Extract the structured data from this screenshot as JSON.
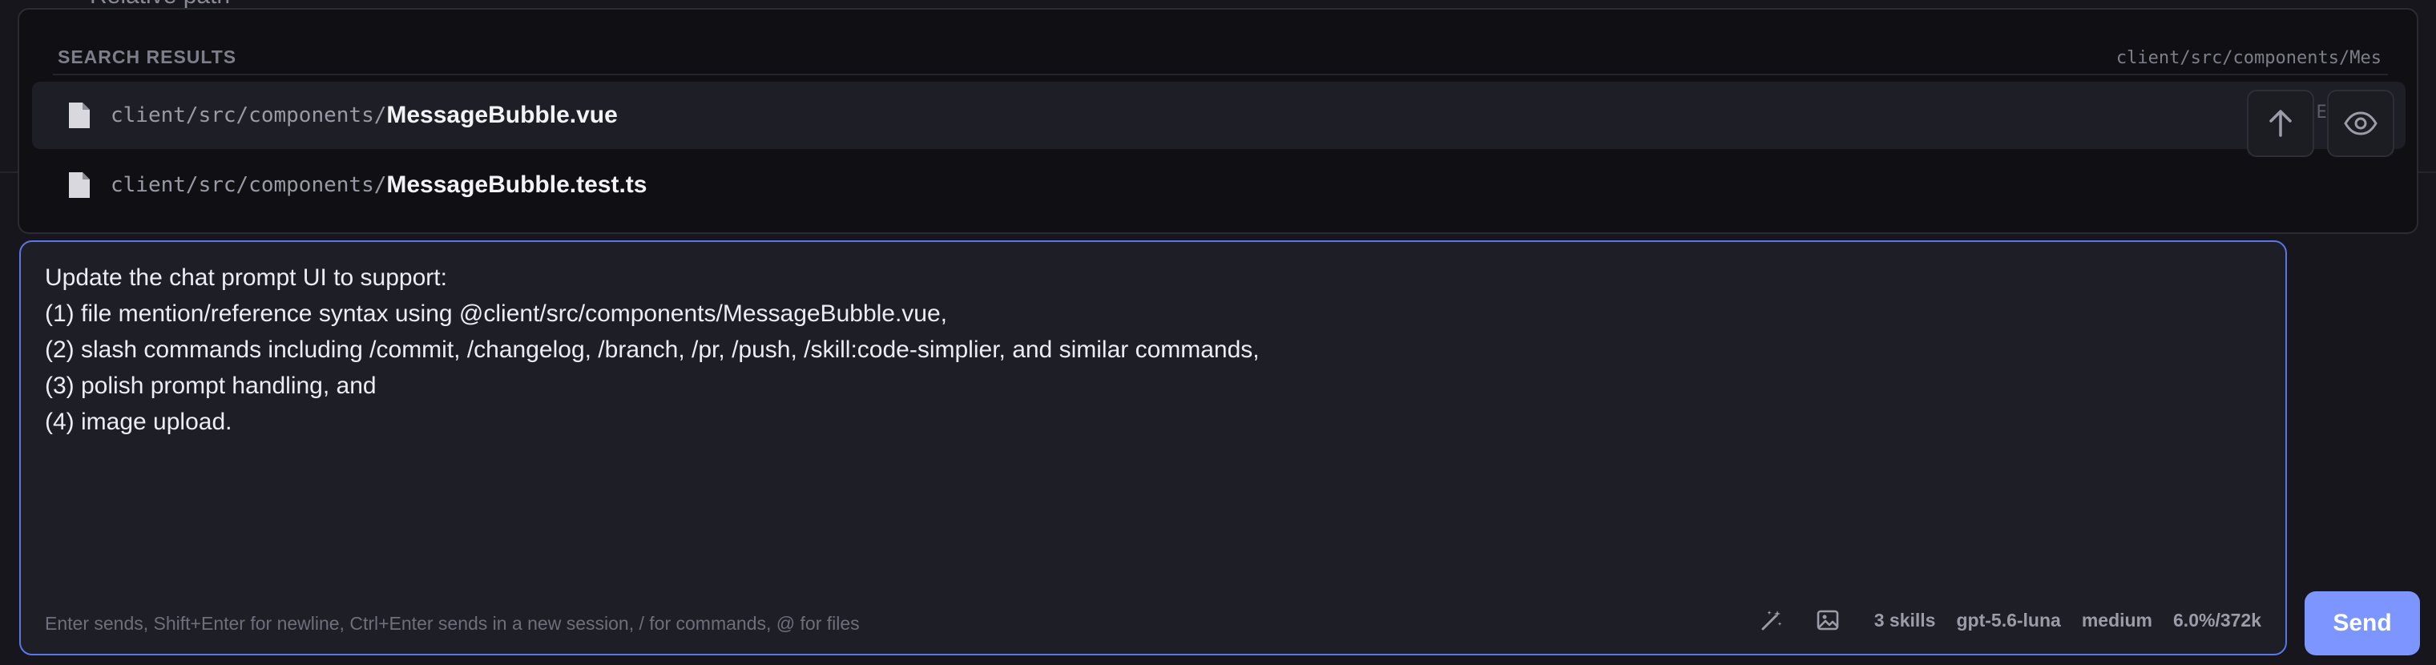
{
  "background": {
    "partial_text": "Relative path"
  },
  "search": {
    "title": "SEARCH RESULTS",
    "current_path": "client/src/components/Mes",
    "peek_text": "C E",
    "results": [
      {
        "dir": "client/src/components/",
        "name": "MessageBubble.vue",
        "active": true
      },
      {
        "dir": "client/src/components/",
        "name": "MessageBubble.test.ts",
        "active": false
      }
    ],
    "icons": {
      "file": "file-icon",
      "scroll_up": "arrow-up-icon",
      "preview": "eye-icon"
    }
  },
  "editor": {
    "lines": [
      "Update the chat prompt UI to support:",
      "(1) file mention/reference syntax using @client/src/components/MessageBubble.vue,",
      "(2) slash commands including /commit, /changelog, /branch, /pr, /push, /skill:code-simplier, and similar commands,",
      "(3) polish prompt handling, and",
      "(4) image upload."
    ],
    "hint": "Enter sends, Shift+Enter for newline, Ctrl+Enter sends in a new session, / for commands, @ for files",
    "toolbar": {
      "skills": "3 skills",
      "model": "gpt-5.6-luna",
      "effort": "medium",
      "context": "6.0%/372k"
    }
  },
  "send_label": "Send",
  "colors": {
    "accent": "#5b76e6",
    "send": "#7c95ff",
    "background": "#16161c"
  }
}
